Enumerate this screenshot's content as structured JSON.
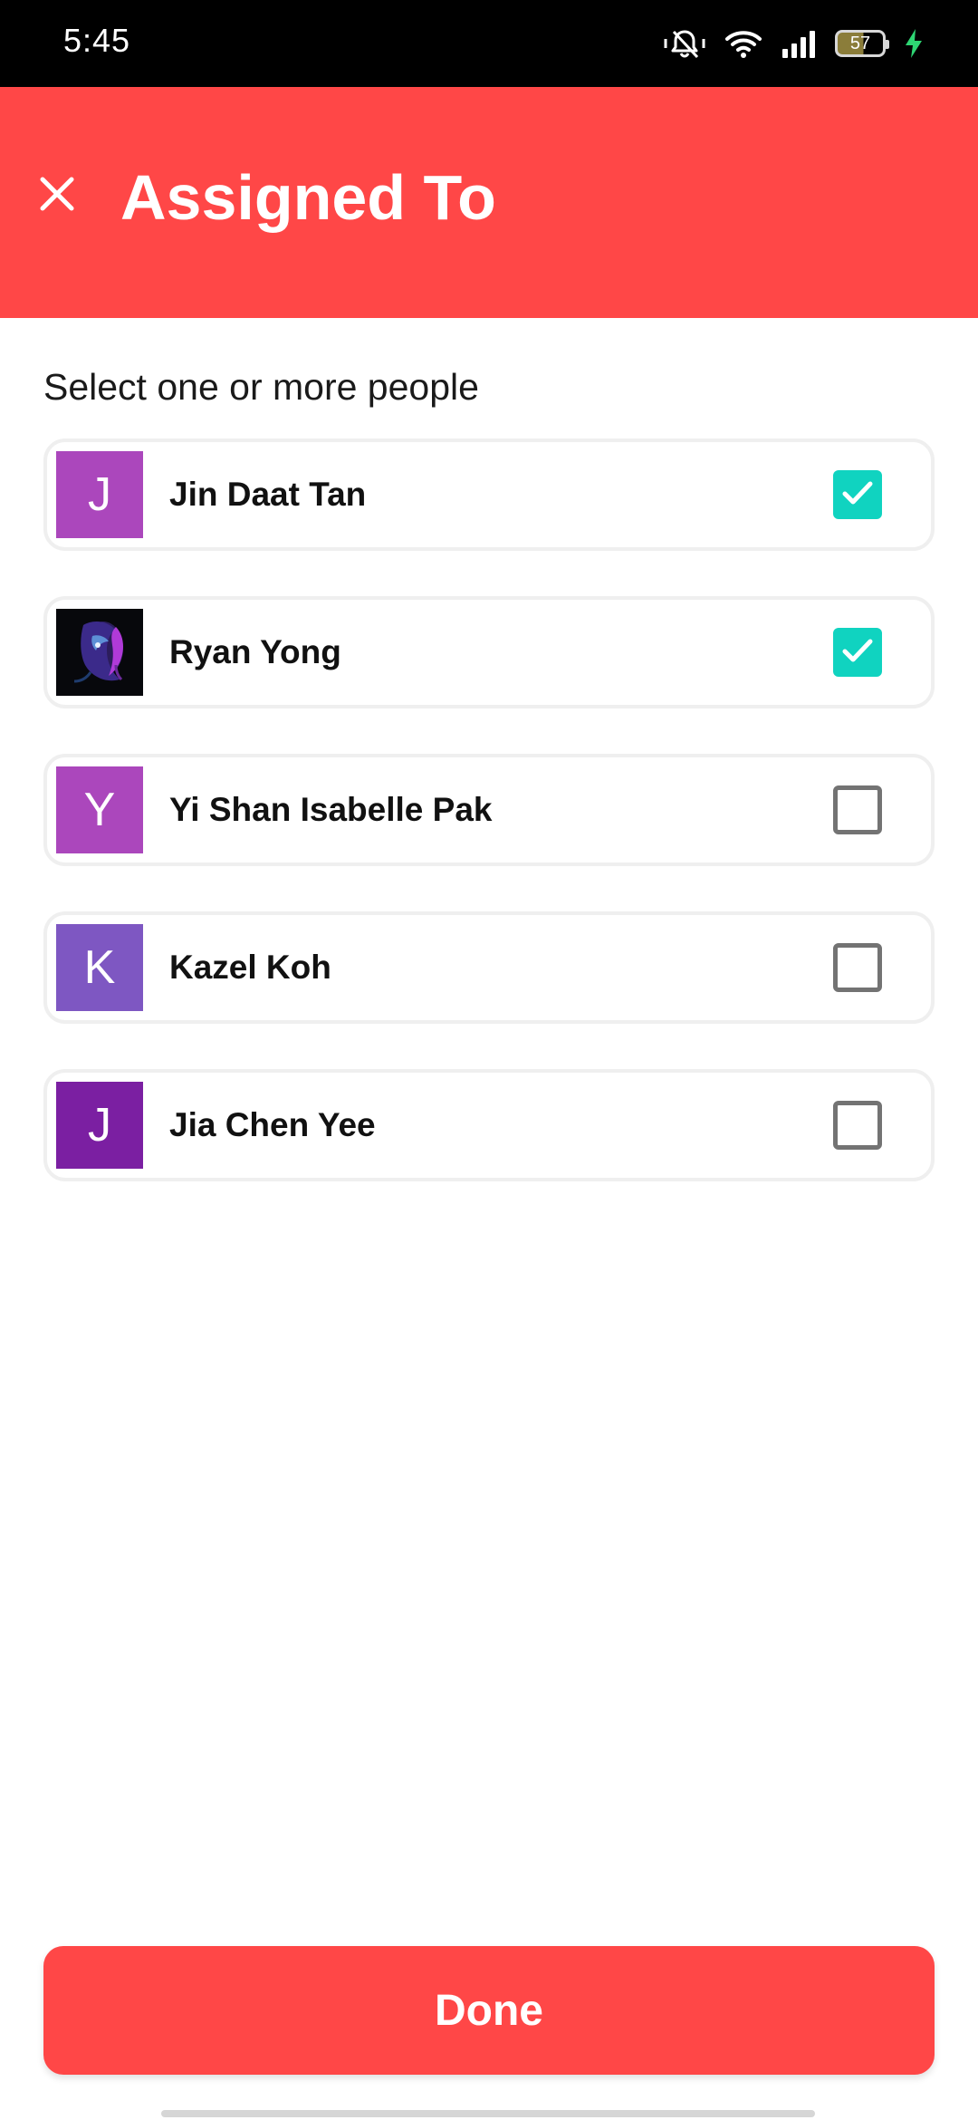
{
  "status_bar": {
    "time": "5:45",
    "battery_level": "57",
    "icons": [
      "silent-bell-icon",
      "wifi-icon",
      "signal-icon",
      "battery-icon",
      "charging-icon"
    ]
  },
  "header": {
    "title": "Assigned To",
    "close_icon": "close-icon",
    "background_color": "#ff4747"
  },
  "instruction": "Select one or more people",
  "people": [
    {
      "initial": "J",
      "name": "Jin Daat Tan",
      "avatar_color": "#ab47bc",
      "avatar_type": "initial",
      "checked": true
    },
    {
      "initial": "",
      "name": "Ryan Yong",
      "avatar_color": "#07080c",
      "avatar_type": "photo",
      "checked": true
    },
    {
      "initial": "Y",
      "name": "Yi Shan Isabelle Pak",
      "avatar_color": "#ab47bc",
      "avatar_type": "initial",
      "checked": false
    },
    {
      "initial": "K",
      "name": "Kazel Koh",
      "avatar_color": "#7e57c2",
      "avatar_type": "initial",
      "checked": false
    },
    {
      "initial": "J",
      "name": "Jia Chen Yee",
      "avatar_color": "#7b1fa2",
      "avatar_type": "initial",
      "checked": false
    }
  ],
  "checkbox_checked_color": "#10d3c0",
  "done_button": {
    "label": "Done",
    "background_color": "#ff4747"
  }
}
